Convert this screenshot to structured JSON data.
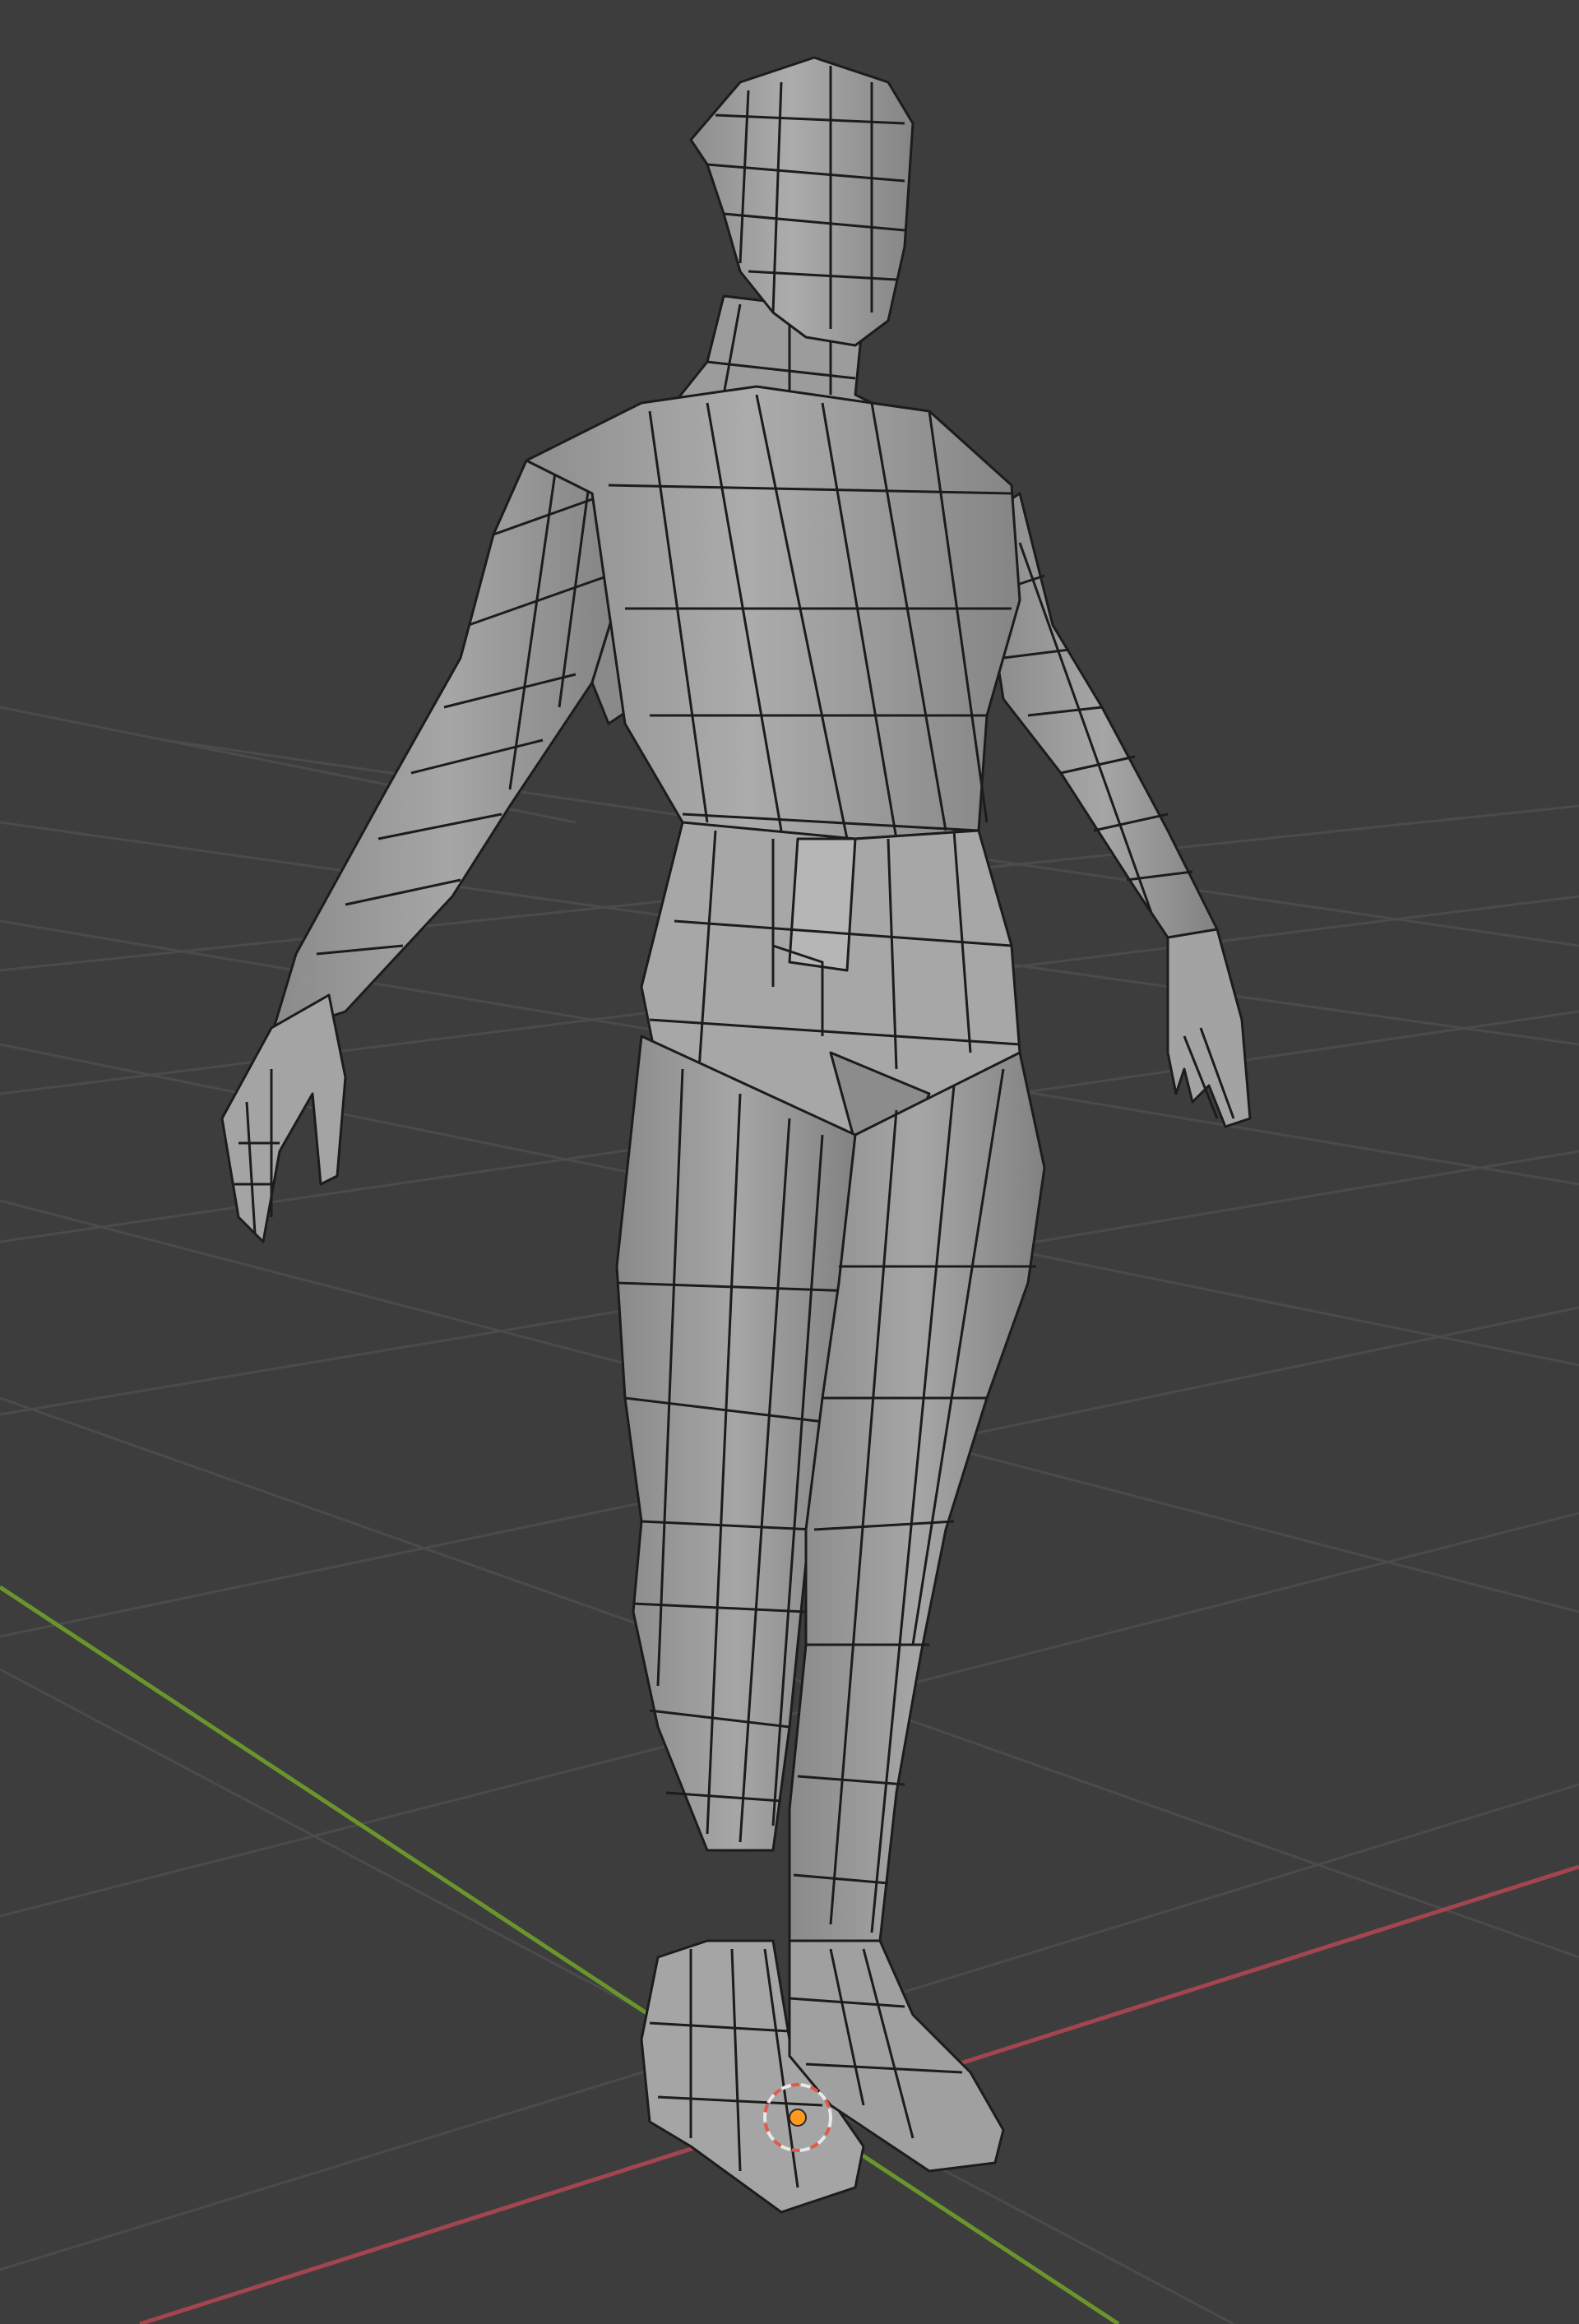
{
  "viewport": {
    "background": "#3d3d3d",
    "grid_color": "#4a4a4a",
    "x_axis_color": "#b04a55",
    "y_axis_color": "#6e9a2c"
  },
  "object": {
    "type": "humanoid-mesh",
    "fill_color": "#9e9e9e",
    "edge_color": "#1c1c1c"
  },
  "origin": {
    "icon": "object-origin-icon",
    "fill_color": "#ff9a1e",
    "ring_color": "#e05a4a"
  }
}
